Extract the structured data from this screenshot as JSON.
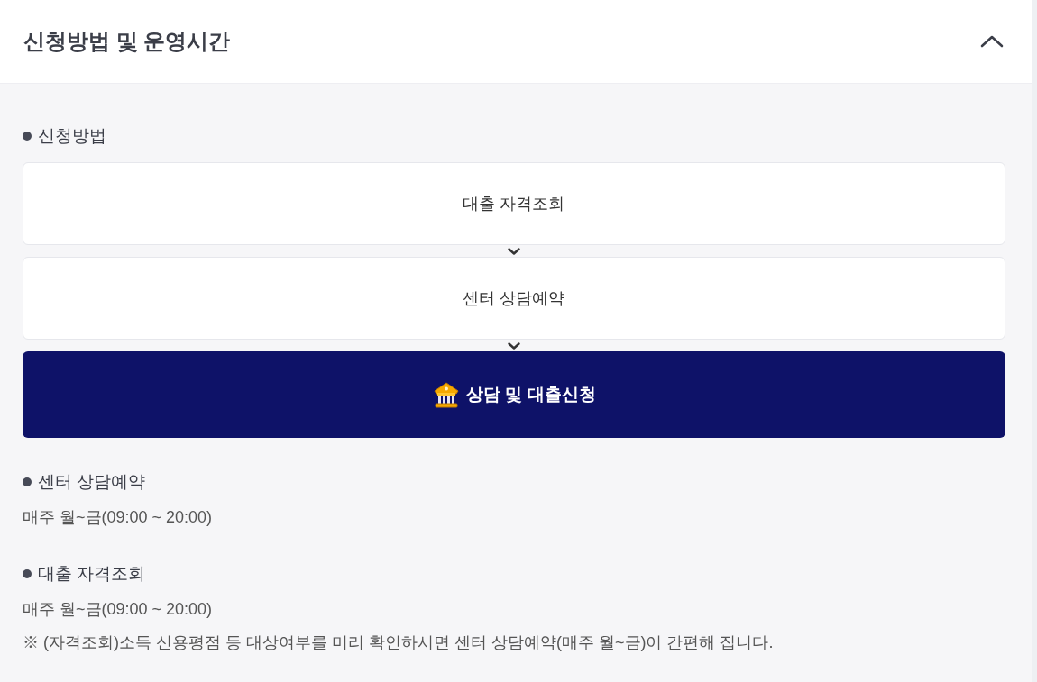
{
  "panel": {
    "title": "신청방법 및 운영시간",
    "expanded": true
  },
  "application": {
    "heading": "신청방법",
    "steps": [
      {
        "label": "대출 자격조회"
      },
      {
        "label": "센터 상담예약"
      }
    ],
    "cta": {
      "label": "상담 및 대출신청"
    }
  },
  "hours": [
    {
      "heading": "센터 상담예약",
      "schedule": "매주 월~금(09:00 ~ 20:00)"
    },
    {
      "heading": "대출 자격조회",
      "schedule": "매주 월~금(09:00 ~ 20:00)",
      "note": "※ (자격조회)소득 신용평점 등 대상여부를 미리 확인하시면 센터 상담예약(매주 월~금)이 간편해 집니다."
    }
  ]
}
